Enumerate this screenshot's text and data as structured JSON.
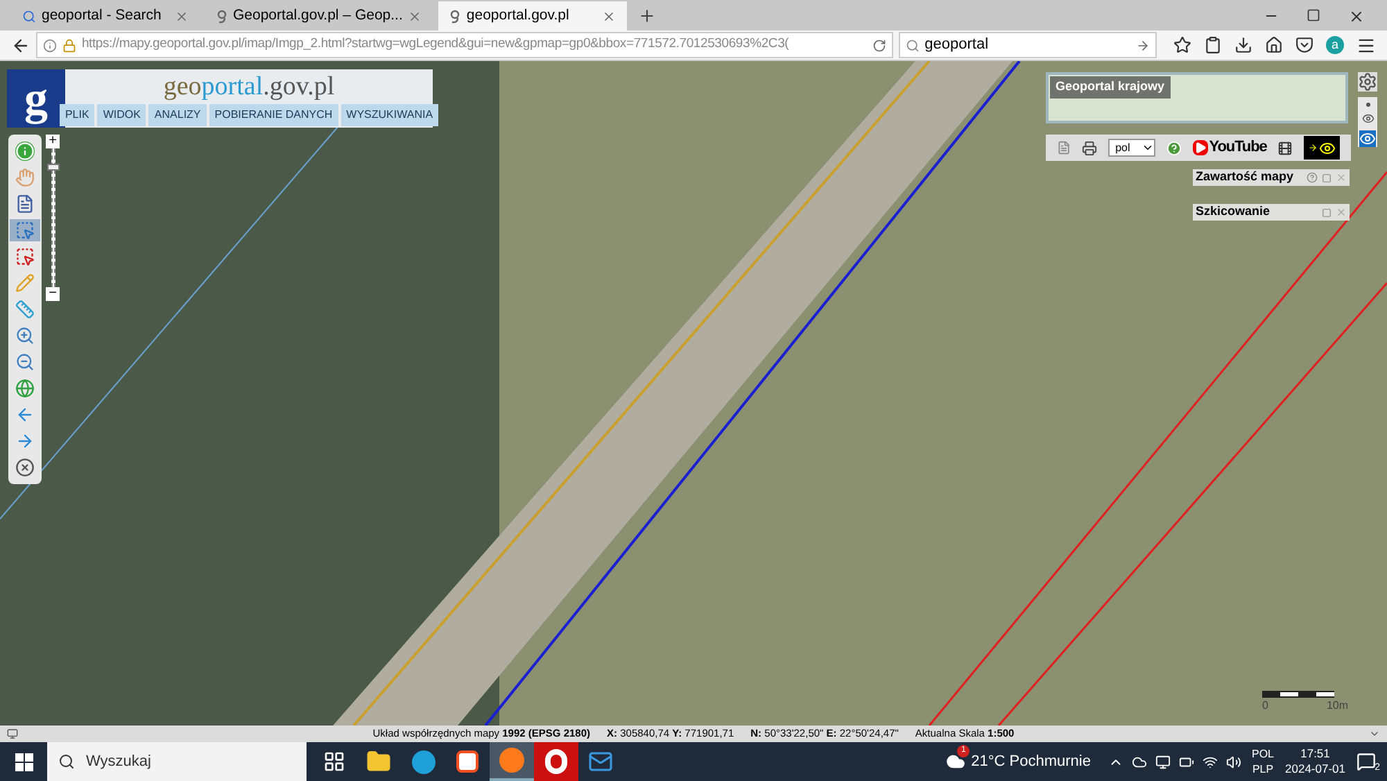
{
  "browser": {
    "tabs": [
      {
        "title": "geoportal - Search",
        "kind": "search",
        "selected": false
      },
      {
        "title": "Geoportal.gov.pl – Geop...",
        "kind": "site",
        "selected": false
      },
      {
        "title": "geoportal.gov.pl",
        "kind": "site",
        "selected": true
      }
    ],
    "url": "https://mapy.geoportal.gov.pl/imap/Imgp_2.html?startwg=wgLegend&gui=new&gpmap=gp0&bbox=771572.7012530693%2C3(",
    "search_value": "geoportal",
    "extension_badge": "a"
  },
  "map": {
    "logo": {
      "mark": "g",
      "part_1": "geo",
      "part_2": "portal",
      "part_3": ".gov.pl"
    },
    "menu": [
      "PLIK",
      "WIDOK",
      "ANALIZY",
      "POBIERANIE DANYCH",
      "WYSZUKIWANIA"
    ],
    "tools": [
      {
        "kind": "info",
        "selected": false
      },
      {
        "kind": "hand",
        "selected": false
      },
      {
        "kind": "legend",
        "selected": false
      },
      {
        "kind": "select",
        "selected": true
      },
      {
        "kind": "edit-selection",
        "selected": false
      },
      {
        "kind": "pencil",
        "selected": false
      },
      {
        "kind": "measure",
        "selected": false
      },
      {
        "kind": "zoom-in",
        "selected": false
      },
      {
        "kind": "zoom-out",
        "selected": false
      },
      {
        "kind": "globe",
        "selected": false
      },
      {
        "kind": "back",
        "selected": false
      },
      {
        "kind": "forward",
        "selected": false
      },
      {
        "kind": "reset",
        "selected": false
      }
    ],
    "zoom": {
      "plus": "+",
      "minus": "−",
      "level": 0.88
    },
    "overview_title": "Geoportal krajowy",
    "language": "pol",
    "youtube": "YouTube",
    "panels": [
      {
        "title": "Zawartość mapy",
        "help": true
      },
      {
        "title": "Szkicowanie",
        "help": false
      }
    ],
    "scale": {
      "start": "0",
      "end": "10m"
    }
  },
  "status": [
    "Układ współrzędnych mapy **1992 (EPSG 2180)**",
    "**X:** 305840,74 **Y:** 771901,71",
    "**N:** 50°33'22,50\" **E:** 22°50'24,47\"",
    "Aktualna Skala **1:500**"
  ],
  "taskbar": {
    "search_placeholder": "Wyszukaj",
    "apps": [
      {
        "kind": "taskview",
        "active": false
      },
      {
        "kind": "folder",
        "active": false
      },
      {
        "kind": "edge",
        "active": false
      },
      {
        "kind": "store",
        "active": false
      },
      {
        "kind": "firefox",
        "active": true
      },
      {
        "kind": "opera",
        "active": false
      },
      {
        "kind": "mail",
        "active": false
      }
    ],
    "weather": "21°C Pochmurnie",
    "weather_badge": "1",
    "lang_1": "POL",
    "lang_2": "PLP",
    "time": "17:51",
    "date": "2024-07-01",
    "notifications": "2"
  }
}
